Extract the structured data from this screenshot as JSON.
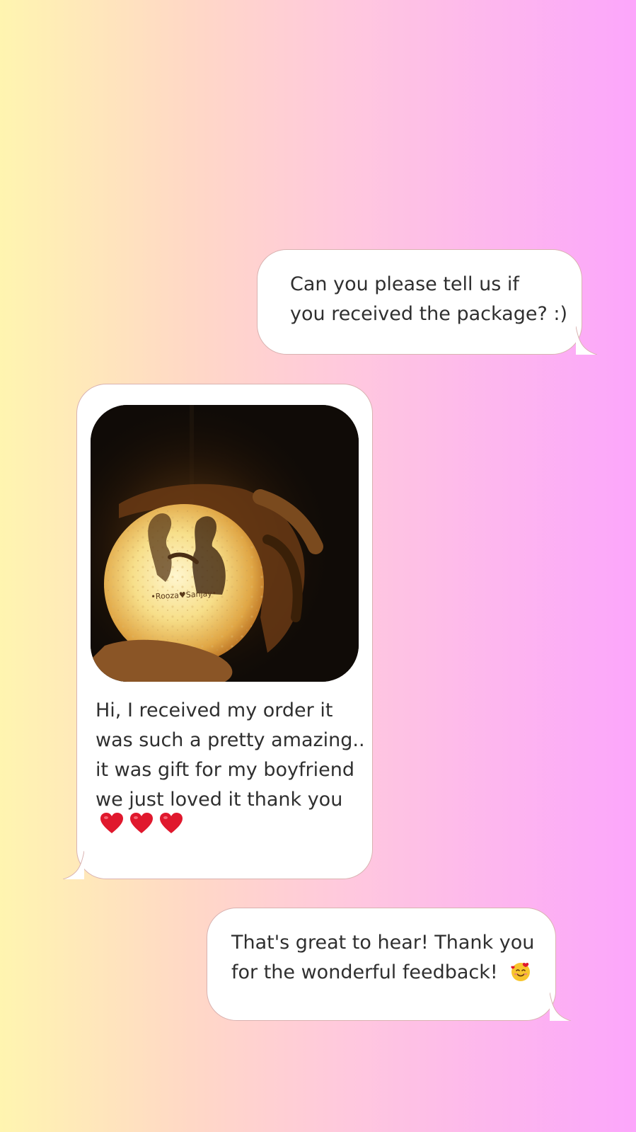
{
  "conversation": {
    "messages": [
      {
        "sender": "shop",
        "lines": [
          "Can you please tell us if",
          "you received the package? :)"
        ]
      },
      {
        "sender": "customer",
        "photo": {
          "caption_on_globe": "•Rooza♥Sanjay•"
        },
        "lines": [
          "Hi, I received my order it",
          "was such a pretty amazing..",
          "it was gift for my boyfriend",
          "we just loved it thank you"
        ],
        "emoji": [
          "heart-emoji",
          "heart-emoji",
          "heart-emoji"
        ]
      },
      {
        "sender": "shop",
        "lines": [
          "That's great to hear! Thank you",
          "for the wonderful feedback!"
        ],
        "emoji": [
          "smiling-face-with-hearts-emoji"
        ]
      }
    ]
  },
  "colors": {
    "gradient_left": "#fff5b0",
    "gradient_right": "#fca6fb",
    "bubble": "#ffffff",
    "bubble_border": "#d9b2b0",
    "text": "#2f2f2f",
    "heart": "#e0182d"
  }
}
